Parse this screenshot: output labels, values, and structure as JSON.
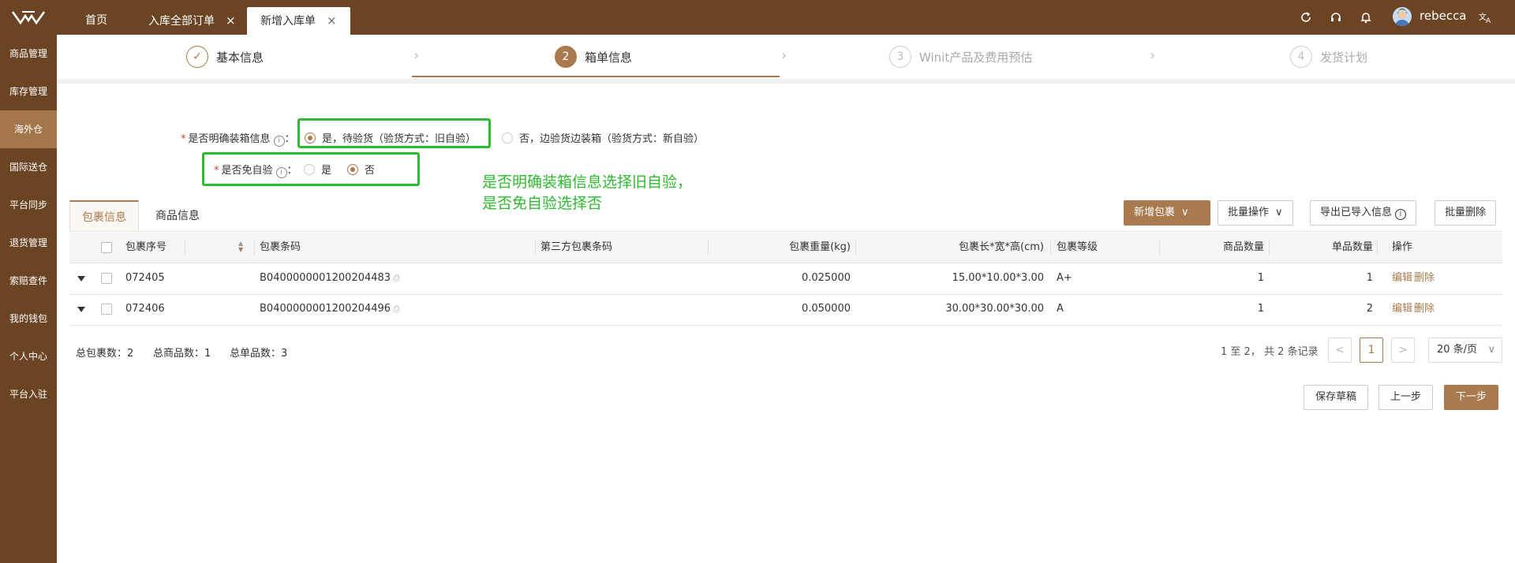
{
  "colors": {
    "brand": "#6b4423",
    "accent": "#a97a4d",
    "annotation": "#2fbb2f"
  },
  "topbar": {
    "tabs": [
      {
        "label": "首页"
      },
      {
        "label": "入库全部订单"
      },
      {
        "label": "新增入库单"
      }
    ],
    "close_glyph": "×",
    "user": "rebecca"
  },
  "sidebar": {
    "items": [
      {
        "label": "商品管理"
      },
      {
        "label": "库存管理"
      },
      {
        "label": "海外仓"
      },
      {
        "label": "国际送仓"
      },
      {
        "label": "平台同步"
      },
      {
        "label": "退货管理"
      },
      {
        "label": "索赔查件"
      },
      {
        "label": "我的钱包"
      },
      {
        "label": "个人中心"
      },
      {
        "label": "平台入驻"
      }
    ]
  },
  "steps": [
    {
      "num": "✓",
      "label": "基本信息"
    },
    {
      "num": "2",
      "label": "箱单信息"
    },
    {
      "num": "3",
      "label": "Winit产品及费用预估"
    },
    {
      "num": "4",
      "label": "发货计划"
    }
  ],
  "form": {
    "packing_label": "是否明确装箱信息",
    "packing_options": [
      "是，待验货（验货方式：旧自验）",
      "否，边验货边装箱（验货方式：新自验）"
    ],
    "exempt_label": "是否免自验",
    "exempt_options": [
      "是",
      "否"
    ],
    "colon": "：",
    "required_mark": "*",
    "info_glyph": "i"
  },
  "annotation": [
    "是否明确装箱信息选择旧自验，",
    "是否免自验选择否"
  ],
  "table_tabs": [
    "包裹信息",
    "商品信息"
  ],
  "actions": {
    "add": "新增包裹",
    "batch": "批量操作",
    "export": "导出已导入信息",
    "batch_delete": "批量删除"
  },
  "table": {
    "headers": [
      "包裹序号",
      "包裹条码",
      "第三方包裹条码",
      "包裹重量(kg)",
      "包裹长*宽*高(cm)",
      "包裹等级",
      "商品数量",
      "单品数量",
      "操作"
    ],
    "rows": [
      {
        "seq": "072405",
        "barcode": "B0400000001200204483",
        "third": "",
        "weight": "0.025000",
        "dims": "15.00*10.00*3.00",
        "grade": "A+",
        "qty": "1",
        "units": "1",
        "edit": "编辑",
        "del": "删除"
      },
      {
        "seq": "072406",
        "barcode": "B0400000001200204496",
        "third": "",
        "weight": "0.050000",
        "dims": "30.00*30.00*30.00",
        "grade": "A",
        "qty": "1",
        "units": "2",
        "edit": "编辑",
        "del": "删除"
      }
    ]
  },
  "summary": {
    "packages": "总包裹数：",
    "packages_val": "2",
    "goods": "总商品数：",
    "goods_val": "1",
    "units": "总单品数：",
    "units_val": "3"
  },
  "pager": {
    "info": "1 至 2， 共 2 条记录",
    "prev": "<",
    "current": "1",
    "next": ">",
    "size": "20 条/页"
  },
  "footer": {
    "save": "保存草稿",
    "prev": "上一步",
    "next": "下一步"
  }
}
